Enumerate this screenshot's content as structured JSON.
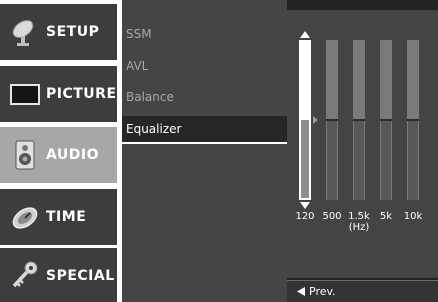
{
  "categories": [
    {
      "label": "SETUP",
      "icon": "satellite-dish-icon"
    },
    {
      "label": "PICTURE",
      "icon": "tv-screen-icon"
    },
    {
      "label": "AUDIO",
      "icon": "speaker-icon"
    },
    {
      "label": "TIME",
      "icon": "clock-icon"
    },
    {
      "label": "SPECIAL",
      "icon": "key-icon"
    }
  ],
  "active_category": "AUDIO",
  "submenu": {
    "items": [
      "SSM",
      "AVL",
      "Balance",
      "Equalizer"
    ],
    "selected": "Equalizer"
  },
  "equalizer": {
    "bands": [
      "120",
      "500",
      "1.5k",
      "5k",
      "10k"
    ],
    "unit": "(Hz)",
    "levels": [
      0.5,
      0.5,
      0.5,
      0.5,
      0.5
    ],
    "selected_band": "120"
  },
  "footer": {
    "prev_label": "Prev.",
    "prev_icon": "left-triangle-icon"
  },
  "colors": {
    "active_tab": "#a7a7a7",
    "inactive_tab": "#3d3d3d",
    "slider_selected": "#ffffff",
    "slider_track": "#7a7a7a"
  }
}
